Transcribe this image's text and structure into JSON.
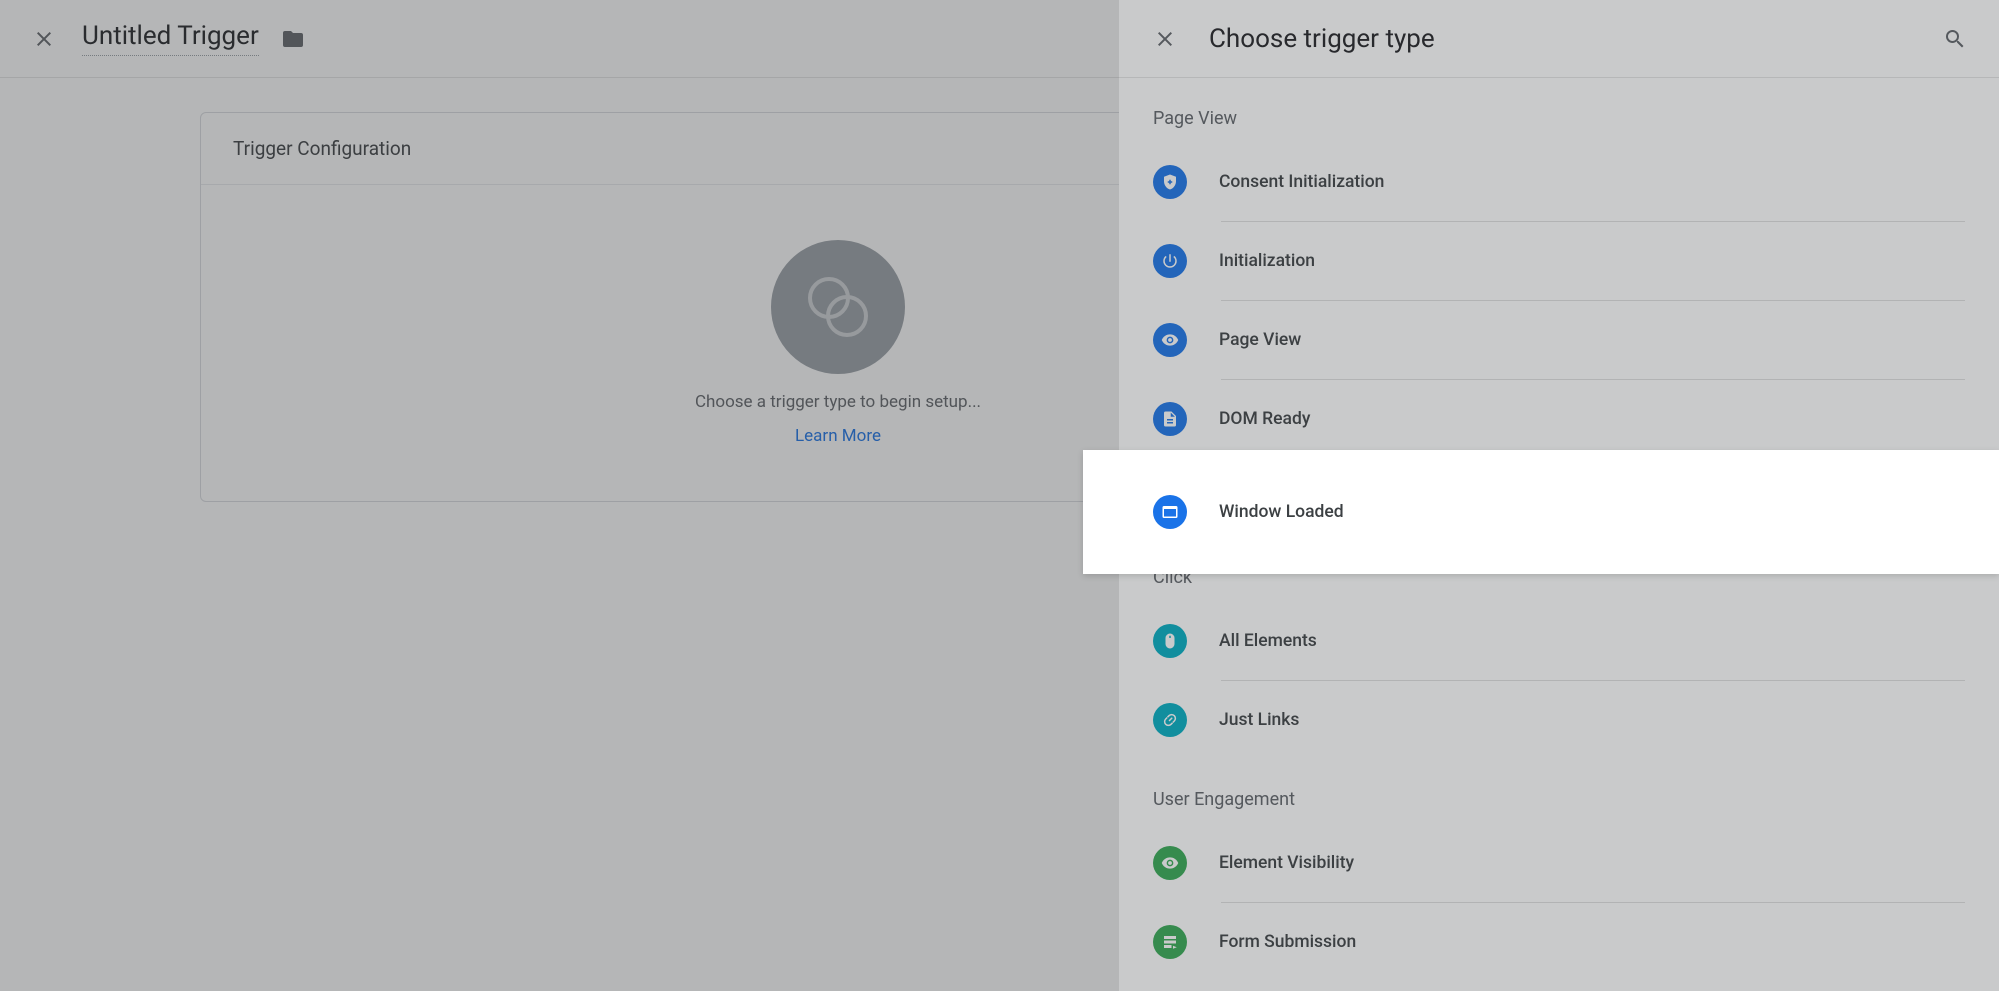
{
  "page": {
    "title": "Untitled Trigger",
    "card_header": "Trigger Configuration",
    "placeholder_text": "Choose a trigger type to begin setup...",
    "learn_more": "Learn More"
  },
  "drawer": {
    "title": "Choose trigger type",
    "groups": [
      {
        "label": "Page View",
        "items": [
          {
            "id": "consent-init",
            "label": "Consent Initialization",
            "icon": "shield-plus-icon",
            "color": "c-blue"
          },
          {
            "id": "init",
            "label": "Initialization",
            "icon": "power-icon",
            "color": "c-blue"
          },
          {
            "id": "page-view",
            "label": "Page View",
            "icon": "eye-icon",
            "color": "c-blue"
          },
          {
            "id": "dom-ready",
            "label": "DOM Ready",
            "icon": "file-icon",
            "color": "c-blue"
          },
          {
            "id": "window-loaded",
            "label": "Window Loaded",
            "icon": "window-icon",
            "color": "c-blue",
            "highlighted": true
          }
        ]
      },
      {
        "label": "Click",
        "items": [
          {
            "id": "all-elements",
            "label": "All Elements",
            "icon": "mouse-icon",
            "color": "c-cyan"
          },
          {
            "id": "just-links",
            "label": "Just Links",
            "icon": "link-icon",
            "color": "c-cyan"
          }
        ]
      },
      {
        "label": "User Engagement",
        "items": [
          {
            "id": "element-visibility",
            "label": "Element Visibility",
            "icon": "eye-icon",
            "color": "c-green"
          },
          {
            "id": "form-submission",
            "label": "Form Submission",
            "icon": "form-icon",
            "color": "c-green"
          }
        ]
      }
    ]
  }
}
